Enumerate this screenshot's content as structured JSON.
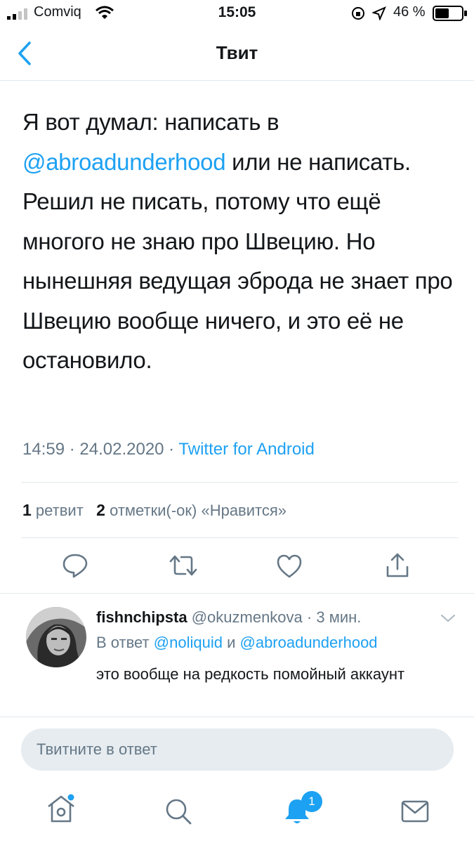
{
  "status_bar": {
    "carrier": "Comviq",
    "time": "15:05",
    "battery_percent": "46 %"
  },
  "header": {
    "title": "Твит"
  },
  "tweet": {
    "text_part1": "Я вот думал: написать в",
    "mention": "@abroadunderhood",
    "text_part2": " или не написать. Решил не писать, потому что ещё многого не знаю про Швецию. Но нынешняя ведущая эброда не знает про Швецию вообще ничего, и это её не остановило.",
    "time": "14:59",
    "date": "24.02.2020",
    "source": "Twitter for Android",
    "separator": " · "
  },
  "stats": {
    "retweets_count": "1",
    "retweets_label": "ретвит",
    "likes_count": "2",
    "likes_label": "отметки(-ок) «Нравится»"
  },
  "actions": [
    {
      "icon": "reply-icon"
    },
    {
      "icon": "retweet-icon"
    },
    {
      "icon": "like-icon"
    },
    {
      "icon": "share-icon"
    }
  ],
  "reply": {
    "display_name": "fishnchipsta",
    "handle": "@okuzmenkova",
    "time_ago": "· 3 мин.",
    "reply_to_prefix": "В ответ",
    "reply_to_user1": "@noliquid",
    "reply_to_and": "и",
    "reply_to_user2": "@abroadunderhood",
    "text": "это вообще на редкость помойный аккаунт"
  },
  "compose": {
    "placeholder": "Твитните в ответ"
  },
  "tab_bar": {
    "notifications_badge": "1"
  },
  "colors": {
    "accent": "#1da1f2",
    "secondary_text": "#657786",
    "divider": "#e1e8ed",
    "compose_bg": "#e6ecf0"
  }
}
